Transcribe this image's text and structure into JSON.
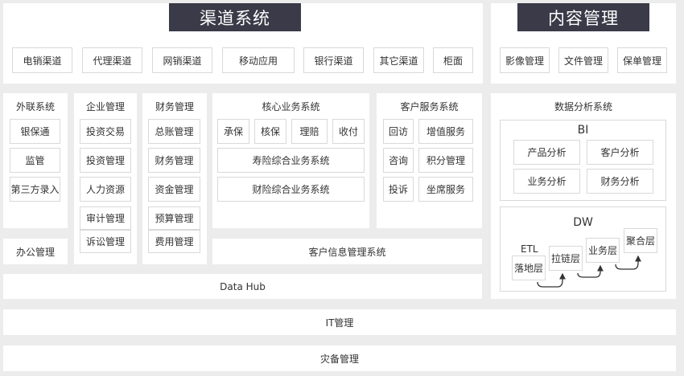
{
  "channels": {
    "title": "渠道系统",
    "items": [
      "电销渠道",
      "代理渠道",
      "网销渠道",
      "移动应用",
      "银行渠道",
      "其它渠道",
      "柜面"
    ]
  },
  "content": {
    "title": "内容管理",
    "items": [
      "影像管理",
      "文件管理",
      "保单管理"
    ]
  },
  "external": {
    "title": "外联系统",
    "items": [
      "银保通",
      "监管",
      "第三方录入"
    ]
  },
  "office": "办公管理",
  "enterprise": {
    "title": "企业管理",
    "items": [
      "投资交易",
      "投资管理",
      "人力资源",
      "审计管理",
      "诉讼管理"
    ]
  },
  "finance": {
    "title": "财务管理",
    "items": [
      "总账管理",
      "财务管理",
      "资金管理",
      "预算管理",
      "费用管理"
    ]
  },
  "core": {
    "title": "核心业务系统",
    "row1": [
      "承保",
      "核保",
      "理赔",
      "收付"
    ],
    "life": "寿险综合业务系统",
    "property": "财险综合业务系统"
  },
  "customer_service": {
    "title": "客户服务系统",
    "items": [
      "回访",
      "增值服务",
      "咨询",
      "积分管理",
      "投诉",
      "坐席服务"
    ]
  },
  "cim": "客户信息管理系统",
  "analytics": {
    "title": "数据分析系统",
    "bi": {
      "title": "BI",
      "items": [
        "产品分析",
        "客户分析",
        "业务分析",
        "财务分析"
      ]
    },
    "dw": {
      "title": "DW",
      "etl": "ETL",
      "layers": [
        "落地层",
        "拉链层",
        "业务层",
        "聚合层"
      ]
    }
  },
  "datahub": "Data Hub",
  "it": "IT管理",
  "dr": "灾备管理"
}
